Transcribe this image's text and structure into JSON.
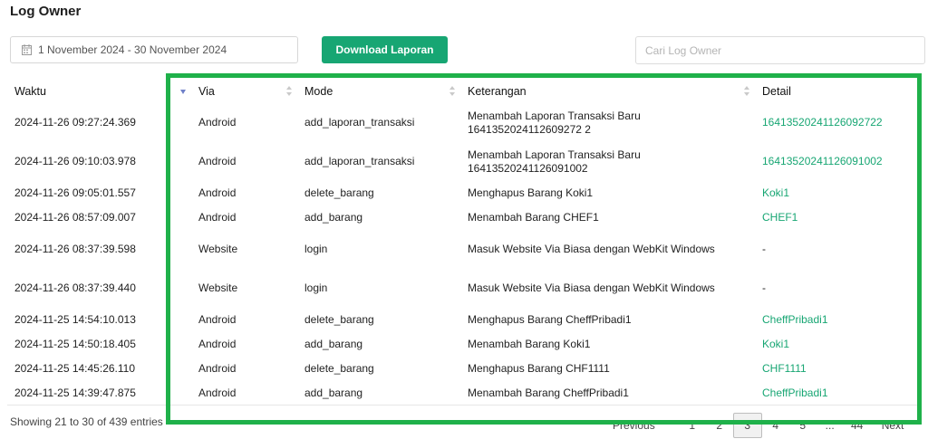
{
  "page": {
    "title": "Log Owner"
  },
  "filters": {
    "date_range": "1 November 2024 - 30 November 2024",
    "download_label": "Download Laporan",
    "search_placeholder": "Cari Log Owner"
  },
  "table": {
    "columns": [
      "Waktu",
      "Via",
      "Mode",
      "Keterangan",
      "Detail"
    ],
    "rows": [
      {
        "waktu": "2024-11-26 09:27:24.369",
        "via": "Android",
        "mode": "add_laporan_transaksi",
        "keterangan": "Menambah Laporan Transaksi Baru 1641352024112609272 2",
        "detail": "16413520241126092722"
      },
      {
        "waktu": "2024-11-26 09:10:03.978",
        "via": "Android",
        "mode": "add_laporan_transaksi",
        "keterangan": "Menambah Laporan Transaksi Baru 16413520241126091002",
        "detail": "16413520241126091002"
      },
      {
        "waktu": "2024-11-26 09:05:01.557",
        "via": "Android",
        "mode": "delete_barang",
        "keterangan": "Menghapus Barang Koki1",
        "detail": "Koki1"
      },
      {
        "waktu": "2024-11-26 08:57:09.007",
        "via": "Android",
        "mode": "add_barang",
        "keterangan": "Menambah Barang CHEF1",
        "detail": "CHEF1"
      },
      {
        "waktu": "2024-11-26 08:37:39.598",
        "via": "Website",
        "mode": "login",
        "keterangan": "Masuk Website Via Biasa dengan WebKit Windows",
        "detail": "-"
      },
      {
        "waktu": "2024-11-26 08:37:39.440",
        "via": "Website",
        "mode": "login",
        "keterangan": "Masuk Website Via Biasa dengan WebKit Windows",
        "detail": "-"
      },
      {
        "waktu": "2024-11-25 14:54:10.013",
        "via": "Android",
        "mode": "delete_barang",
        "keterangan": "Menghapus Barang CheffPribadi1",
        "detail": "CheffPribadi1"
      },
      {
        "waktu": "2024-11-25 14:50:18.405",
        "via": "Android",
        "mode": "add_barang",
        "keterangan": "Menambah Barang Koki1",
        "detail": "Koki1"
      },
      {
        "waktu": "2024-11-25 14:45:26.110",
        "via": "Android",
        "mode": "delete_barang",
        "keterangan": "Menghapus Barang CHF1111",
        "detail": "CHF1111"
      },
      {
        "waktu": "2024-11-25 14:39:47.875",
        "via": "Android",
        "mode": "add_barang",
        "keterangan": "Menambah Barang CheffPribadi1",
        "detail": "CheffPribadi1"
      }
    ]
  },
  "footer": {
    "showing": "Showing 21 to 30 of 439 entries",
    "pagination": {
      "prev": "Previous",
      "pages": [
        "1",
        "2",
        "3",
        "4",
        "5",
        "...",
        "44"
      ],
      "active_page": "3",
      "next": "Next"
    }
  },
  "colors": {
    "accent": "#17a673",
    "highlight": "#1fb14a",
    "sort_active": "#6f80c8"
  }
}
